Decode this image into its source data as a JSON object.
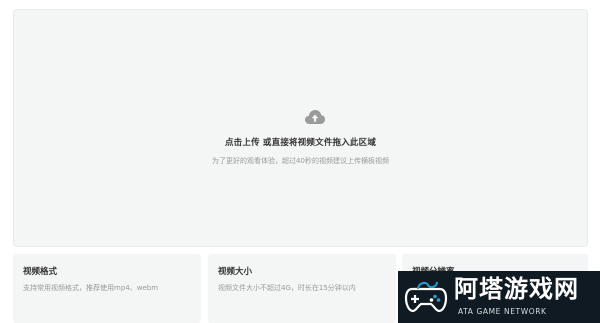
{
  "upload": {
    "title": "点击上传 或直接将视频文件拖入此区域",
    "subtitle": "为了更好的观看体验，超过40秒的视频建议上传横板视频",
    "icon": "cloud-upload-icon"
  },
  "cards": [
    {
      "title": "视频格式",
      "desc": "支持常用视频格式，推荐使用mp4、webm"
    },
    {
      "title": "视频大小",
      "desc": "视频文件大小不超过4G，时长在15分钟以内"
    },
    {
      "title": "视频分辨率",
      "desc": ""
    }
  ],
  "watermark": {
    "title": "阿塔游戏网",
    "subtitle": "ATA GAME NETWORK",
    "icon": "gamepad-logo-icon",
    "accent": "#2a9fd6"
  }
}
